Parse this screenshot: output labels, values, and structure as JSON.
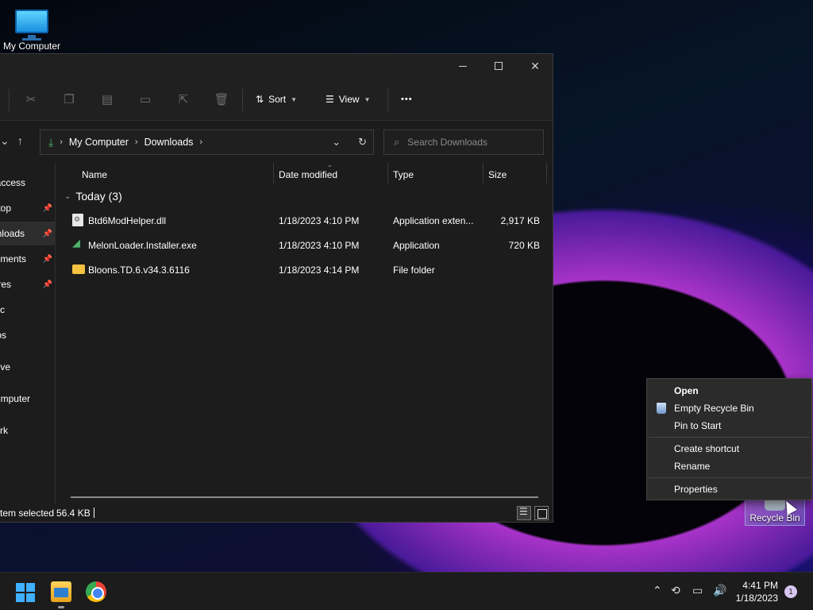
{
  "desktop": {
    "my_computer_label": "My Computer",
    "recycle_bin_label": "Recycle Bin"
  },
  "explorer": {
    "toolbar": {
      "sort_label": "Sort",
      "view_label": "View",
      "more_label": "•••"
    },
    "address": {
      "crumbs": [
        "My Computer",
        "Downloads"
      ]
    },
    "search": {
      "placeholder": "Search Downloads"
    },
    "sidebar": {
      "items": [
        {
          "label": "access",
          "pinned": false
        },
        {
          "label": "top",
          "pinned": true
        },
        {
          "label": "nloads",
          "pinned": true,
          "selected": true
        },
        {
          "label": "ments",
          "pinned": true
        },
        {
          "label": "res",
          "pinned": true
        },
        {
          "label": "c",
          "pinned": false
        },
        {
          "label": "os",
          "pinned": false
        },
        {
          "label": "ive",
          "pinned": false
        },
        {
          "label": "mputer",
          "pinned": false
        },
        {
          "label": "rk",
          "pinned": false
        }
      ]
    },
    "columns": {
      "name": "Name",
      "date": "Date modified",
      "type": "Type",
      "size": "Size"
    },
    "group": {
      "label": "Today (3)"
    },
    "files": [
      {
        "name": "Btd6ModHelper.dll",
        "date": "1/18/2023 4:10 PM",
        "type": "Application exten...",
        "size": "2,917 KB",
        "icon": "dll-file-icon"
      },
      {
        "name": "MelonLoader.Installer.exe",
        "date": "1/18/2023 4:10 PM",
        "type": "Application",
        "size": "720 KB",
        "icon": "exe-file-icon"
      },
      {
        "name": "Bloons.TD.6.v34.3.6116",
        "date": "1/18/2023 4:14 PM",
        "type": "File folder",
        "size": "",
        "icon": "folder-icon"
      }
    ],
    "status": {
      "selected": "tem selected",
      "size": "56.4 KB"
    }
  },
  "context_menu": {
    "open": "Open",
    "empty": "Empty Recycle Bin",
    "pin": "Pin to Start",
    "shortcut": "Create shortcut",
    "rename": "Rename",
    "properties": "Properties"
  },
  "taskbar": {
    "time": "4:41 PM",
    "date": "1/18/2023",
    "notifications": "1"
  },
  "colors": {
    "accent": "#3fb0ff",
    "window_bg": "#1c1c1c",
    "menu_bg": "#2b2b2b"
  }
}
